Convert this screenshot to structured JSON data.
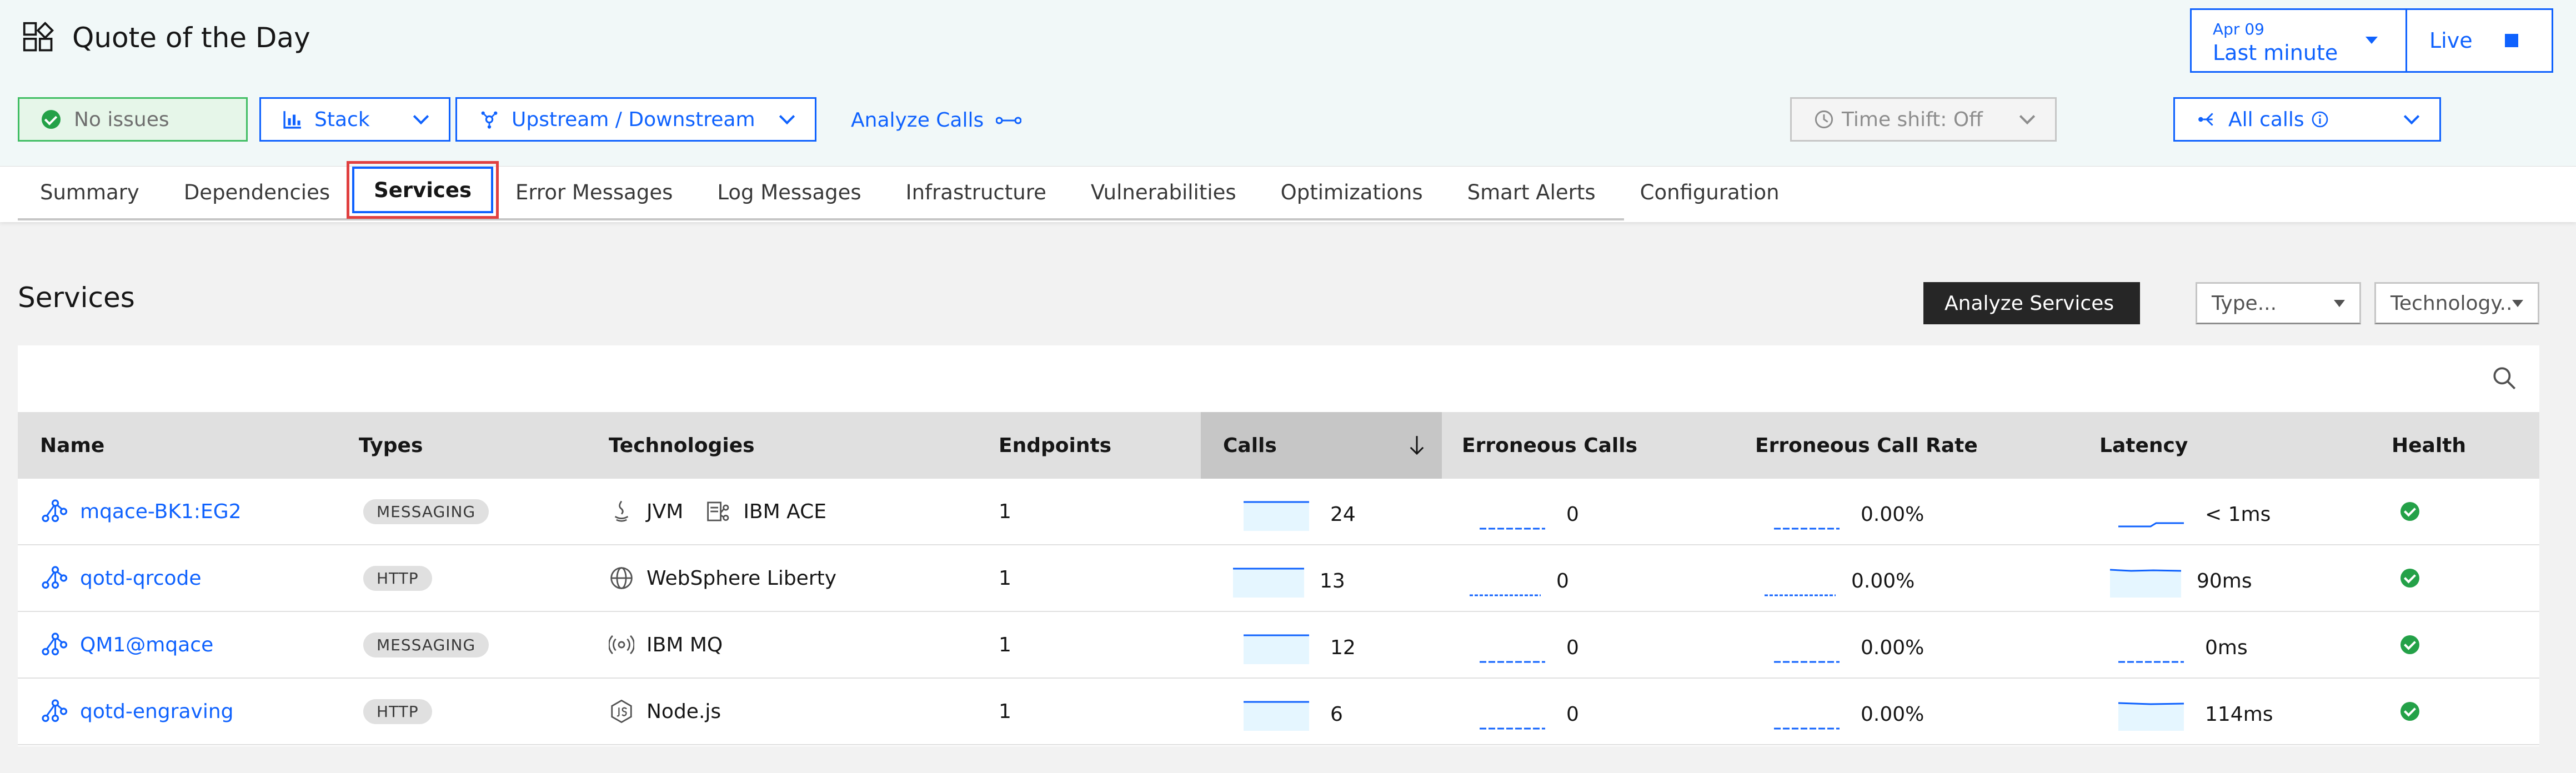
{
  "app": {
    "title": "Quote of the Day"
  },
  "time_picker": {
    "date": "Apr 09",
    "range": "Last minute",
    "live_label": "Live"
  },
  "toolbar": {
    "status": "No issues",
    "stack_label": "Stack",
    "updown_label": "Upstream / Downstream",
    "analyze_calls_label": "Analyze Calls",
    "timeshift_label": "Time shift: Off",
    "allcalls_label": "All calls"
  },
  "tabs": [
    {
      "label": "Summary"
    },
    {
      "label": "Dependencies"
    },
    {
      "label": "Services"
    },
    {
      "label": "Error Messages"
    },
    {
      "label": "Log Messages"
    },
    {
      "label": "Infrastructure"
    },
    {
      "label": "Vulnerabilities"
    },
    {
      "label": "Optimizations"
    },
    {
      "label": "Smart Alerts"
    },
    {
      "label": "Configuration"
    }
  ],
  "active_tab": "Services",
  "section": {
    "title": "Services",
    "analyze_label": "Analyze Services",
    "filter_type": "Type...",
    "filter_tech": "Technology.."
  },
  "table": {
    "headers": {
      "name": "Name",
      "types": "Types",
      "technologies": "Technologies",
      "endpoints": "Endpoints",
      "calls": "Calls",
      "erroneous_calls": "Erroneous Calls",
      "error_rate": "Erroneous Call Rate",
      "latency": "Latency",
      "health": "Health"
    },
    "rows": [
      {
        "name": "mqace-BK1:EG2",
        "type": "MESSAGING",
        "tech": [
          "JVM",
          "IBM ACE"
        ],
        "endpoints": "1",
        "calls": "24",
        "erroneous": "0",
        "rate": "0.00%",
        "latency": "< 1ms"
      },
      {
        "name": "qotd-qrcode",
        "type": "HTTP",
        "tech": [
          "WebSphere Liberty"
        ],
        "endpoints": "1",
        "calls": "13",
        "erroneous": "0",
        "rate": "0.00%",
        "latency": "90ms"
      },
      {
        "name": "QM1@mqace",
        "type": "MESSAGING",
        "tech": [
          "IBM MQ"
        ],
        "endpoints": "1",
        "calls": "12",
        "erroneous": "0",
        "rate": "0.00%",
        "latency": "0ms"
      },
      {
        "name": "qotd-engraving",
        "type": "HTTP",
        "tech": [
          "Node.js"
        ],
        "endpoints": "1",
        "calls": "6",
        "erroneous": "0",
        "rate": "0.00%",
        "latency": "114ms"
      }
    ]
  },
  "colors": {
    "accent": "#0f62fe",
    "success": "#24a148",
    "highlight": "#e04040"
  }
}
